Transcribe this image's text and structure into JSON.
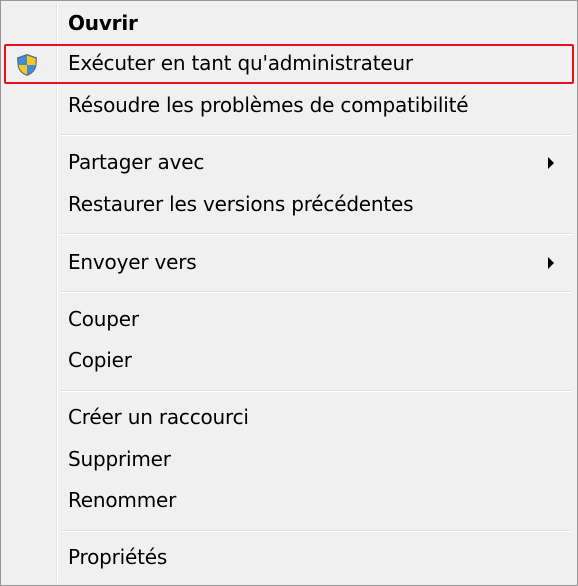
{
  "menu": {
    "items": [
      {
        "label": "Ouvrir"
      },
      {
        "label": "Exécuter en tant qu'administrateur",
        "icon": "uac-shield-icon"
      },
      {
        "label": "Résoudre les problèmes de compatibilité"
      },
      {
        "label": "Partager avec",
        "submenu": true
      },
      {
        "label": "Restaurer les versions précédentes"
      },
      {
        "label": "Envoyer vers",
        "submenu": true
      },
      {
        "label": "Couper"
      },
      {
        "label": "Copier"
      },
      {
        "label": "Créer un raccourci"
      },
      {
        "label": "Supprimer"
      },
      {
        "label": "Renommer"
      },
      {
        "label": "Propriétés"
      }
    ],
    "highlight_color": "#e8101a"
  }
}
